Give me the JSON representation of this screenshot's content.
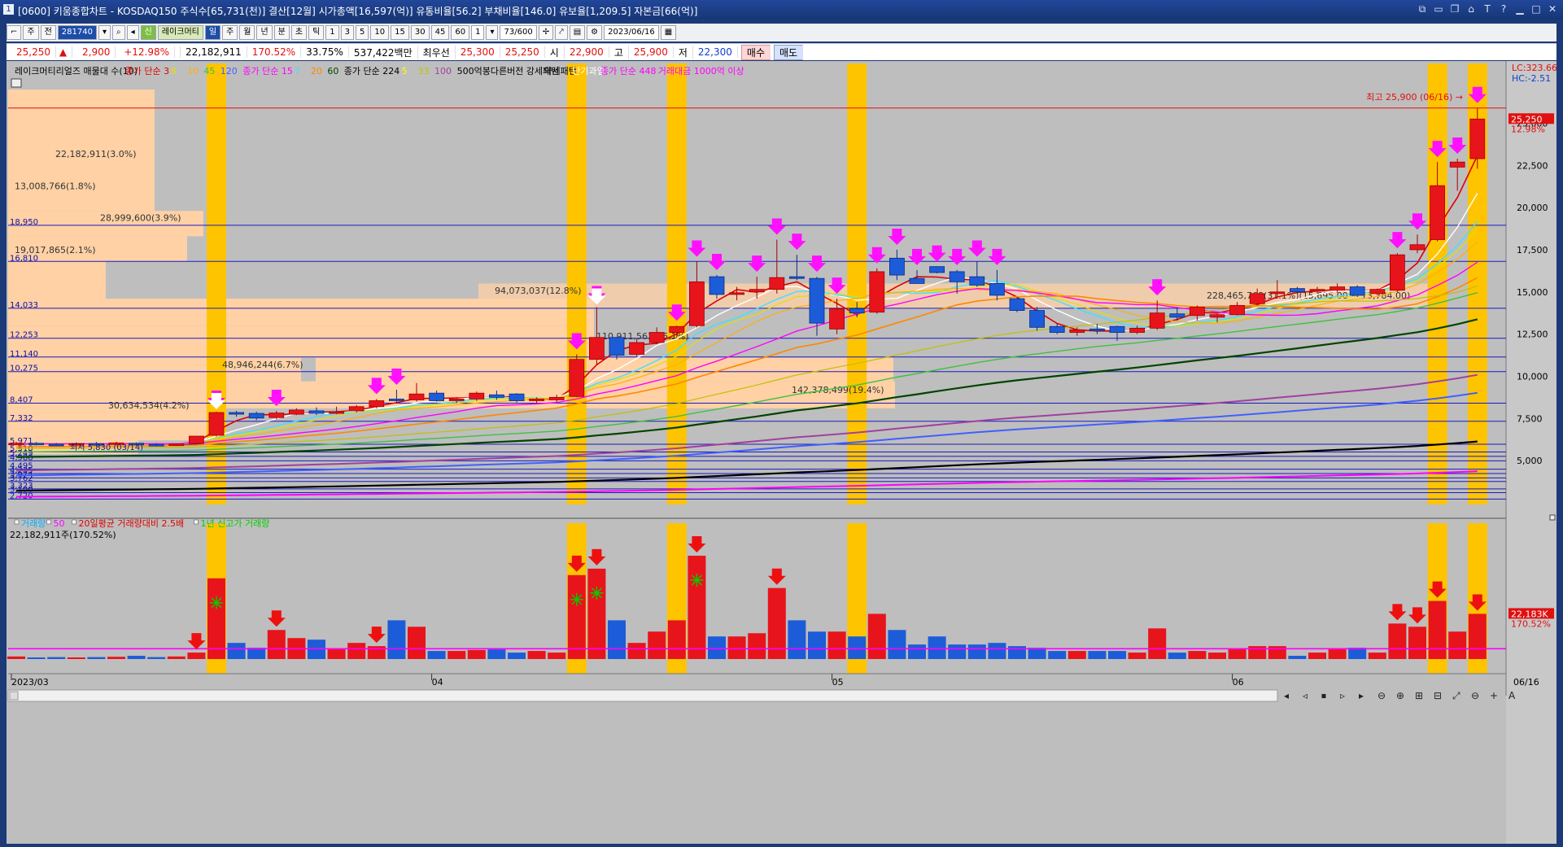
{
  "window": {
    "icon": "1",
    "title": "[0600] 키움종합차트 - KOSDAQ150 주식수[65,731(천)] 결산[12월] 시가총액[16,597(억)] 유통비율[56.2] 부채비율[146.0] 유보율[1,209.5] 자본금[66(억)]"
  },
  "toolbar": {
    "period_label": "주",
    "prev_label": "전",
    "code": "281740",
    "name": "레이크머티",
    "sin_label": "신",
    "periods": [
      "일",
      "주",
      "월",
      "년",
      "분",
      "초",
      "틱"
    ],
    "selected_period": "일",
    "minutes": [
      "1",
      "3",
      "5",
      "10",
      "15",
      "30",
      "45",
      "60"
    ],
    "count_value": "1",
    "data_count": "73",
    "data_max": "/600",
    "date": "2023/06/16"
  },
  "quote": {
    "price": "25,250",
    "change": "2,900",
    "change_pct": "+12.98%",
    "volume": "22,182,911",
    "volume_ratio": "170.52%",
    "turnover": "33.75%",
    "amount": "537,422백만",
    "best_label": "최우선",
    "ask": "25,300",
    "bid": "25,250",
    "open_label": "시",
    "open": "22,900",
    "high_label": "고",
    "high": "25,900",
    "low_label": "저",
    "low": "22,300",
    "buy_label": "매수",
    "sell_label": "매도"
  },
  "colors": {
    "up": "#e8141b",
    "down": "#1d5cd8",
    "profile": "#ffd1a5",
    "highlight": "#ffc400",
    "arrow": "#ff10ff",
    "gridline": "#1a1ac0",
    "background": "#bebebe"
  },
  "legend": [
    {
      "text": "레이크머티리얼즈 매물대 수(10)",
      "color": "#000000"
    },
    {
      "text": "종가 단순 3",
      "color": "#e00000"
    },
    {
      "text": "8",
      "color": "#e0e000"
    },
    {
      "text": "10",
      "color": "#ffb000"
    },
    {
      "text": "45",
      "color": "#40c040"
    },
    {
      "text": "120",
      "color": "#4060ff"
    },
    {
      "text": "종가 단순 15",
      "color": "#ff00ff"
    },
    {
      "text": "7",
      "color": "#40e0ff"
    },
    {
      "text": "20",
      "color": "#ff8800"
    },
    {
      "text": "60",
      "color": "#004400"
    },
    {
      "text": "종가 단순 224",
      "color": "#000000"
    },
    {
      "text": "5",
      "color": "#ffff00"
    },
    {
      "text": "33",
      "color": "#c0c000"
    },
    {
      "text": "100",
      "color": "#a040a0"
    },
    {
      "text": "500억봉다른버전 강세패턴",
      "color": "#000000"
    },
    {
      "text": "약세패턴",
      "color": "#000000"
    },
    {
      "text": "단기과열",
      "color": "#ffffff"
    },
    {
      "text": "종가 단순 448",
      "color": "#ff00ff"
    },
    {
      "text": "거래대금 1000억 이상",
      "color": "#ff00ff"
    }
  ],
  "right_info": {
    "lc": "LC:323.66",
    "hc": "HC:-2.51"
  },
  "price_axis": [
    "25,000",
    "22,500",
    "20,000",
    "17,500",
    "15,000",
    "12,500",
    "10,000",
    "7,500",
    "5,000"
  ],
  "current_tag": {
    "price": "25,250",
    "pct": "12.98%"
  },
  "max_label": "최고 25,900 (06/16) →",
  "price_levels": [
    "18,950",
    "16,810",
    "14,033",
    "12,253",
    "11,140",
    "10,275",
    "8,407",
    "7,332",
    "5,971",
    "5,510",
    "5,249",
    "4,988",
    "4,495",
    "4,235",
    "3,974",
    "3,762",
    "3,323",
    "3,100",
    "2,720"
  ],
  "profile_labels": [
    "22,182,911(3.0%)",
    "13,008,766(1.8%)",
    "28,999,600(3.9%)",
    "19,017,865(2.1%)",
    "94,073,037(12.8%)",
    "110,911,561(15.1%)",
    "48,946,244(6.7%)",
    "30,634,534(4.2%)",
    "142,378,499(19.4%)",
    "228,465,768(31.1%)(15,695.00 ~ 13,784.00)"
  ],
  "min_label": "최저 5,830 (03/14)",
  "volume_legend": [
    {
      "text": "거래량",
      "color": "#00b0ff"
    },
    {
      "text": "50",
      "color": "#ff00ff"
    },
    {
      "text": "20일평균 거래량대비 2.5배",
      "color": "#e00000"
    },
    {
      "text": "1년 신고가 거래량",
      "color": "#00d000"
    }
  ],
  "volume_info": "22,182,911주(170.52%)",
  "volume_tag": {
    "value": "22,183K",
    "pct": "170.52%"
  },
  "date_axis": [
    {
      "label": "2023/03",
      "i": 0
    },
    {
      "label": "04",
      "i": 21
    },
    {
      "label": "05",
      "i": 41
    },
    {
      "label": "06",
      "i": 61
    }
  ],
  "last_date": "06/16",
  "chart_data": {
    "type": "candlestick",
    "symbol_code": "281740",
    "date_range": [
      "2023/03",
      "06/16"
    ],
    "candles": [
      {
        "o": 6000,
        "h": 6120,
        "l": 5920,
        "c": 6030
      },
      {
        "o": 6030,
        "h": 6100,
        "l": 5900,
        "c": 5970
      },
      {
        "o": 5970,
        "h": 6050,
        "l": 5860,
        "c": 5960
      },
      {
        "o": 5960,
        "h": 6080,
        "l": 5900,
        "c": 6010
      },
      {
        "o": 6010,
        "h": 6110,
        "l": 5940,
        "c": 5980
      },
      {
        "o": 5990,
        "h": 6120,
        "l": 5900,
        "c": 6050
      },
      {
        "o": 6030,
        "h": 6080,
        "l": 5880,
        "c": 5960
      },
      {
        "o": 5960,
        "h": 6030,
        "l": 5830,
        "c": 5950
      },
      {
        "o": 5960,
        "h": 6020,
        "l": 5870,
        "c": 5990
      },
      {
        "o": 6010,
        "h": 6450,
        "l": 5980,
        "c": 6450
      },
      {
        "o": 6500,
        "h": 7900,
        "l": 6420,
        "c": 7850
      },
      {
        "o": 7850,
        "h": 7950,
        "l": 7600,
        "c": 7800
      },
      {
        "o": 7800,
        "h": 7900,
        "l": 7400,
        "c": 7520
      },
      {
        "o": 7550,
        "h": 7950,
        "l": 7450,
        "c": 7820
      },
      {
        "o": 7750,
        "h": 8100,
        "l": 7700,
        "c": 8000
      },
      {
        "o": 7950,
        "h": 8150,
        "l": 7700,
        "c": 7800
      },
      {
        "o": 7800,
        "h": 8200,
        "l": 7750,
        "c": 7900
      },
      {
        "o": 7950,
        "h": 8300,
        "l": 7850,
        "c": 8200
      },
      {
        "o": 8200,
        "h": 8650,
        "l": 8100,
        "c": 8550
      },
      {
        "o": 8650,
        "h": 9200,
        "l": 8450,
        "c": 8550
      },
      {
        "o": 8600,
        "h": 9600,
        "l": 8500,
        "c": 8950
      },
      {
        "o": 9000,
        "h": 9150,
        "l": 8500,
        "c": 8550
      },
      {
        "o": 8550,
        "h": 8750,
        "l": 8400,
        "c": 8650
      },
      {
        "o": 8650,
        "h": 9100,
        "l": 8550,
        "c": 9000
      },
      {
        "o": 8900,
        "h": 9150,
        "l": 8600,
        "c": 8750
      },
      {
        "o": 8950,
        "h": 9000,
        "l": 8450,
        "c": 8550
      },
      {
        "o": 8550,
        "h": 8750,
        "l": 8400,
        "c": 8650
      },
      {
        "o": 8600,
        "h": 8900,
        "l": 8450,
        "c": 8750
      },
      {
        "o": 8800,
        "h": 11300,
        "l": 8750,
        "c": 11000
      },
      {
        "o": 11000,
        "h": 14100,
        "l": 10700,
        "c": 12300
      },
      {
        "o": 12300,
        "h": 12350,
        "l": 11000,
        "c": 11250
      },
      {
        "o": 11300,
        "h": 12200,
        "l": 11200,
        "c": 12000
      },
      {
        "o": 12000,
        "h": 12900,
        "l": 11900,
        "c": 12600
      },
      {
        "o": 12600,
        "h": 13000,
        "l": 12300,
        "c": 12950
      },
      {
        "o": 13000,
        "h": 16800,
        "l": 12900,
        "c": 15600
      },
      {
        "o": 15900,
        "h": 16000,
        "l": 14600,
        "c": 14850
      },
      {
        "o": 14850,
        "h": 15300,
        "l": 14500,
        "c": 14950
      },
      {
        "o": 15000,
        "h": 15900,
        "l": 14600,
        "c": 15150
      },
      {
        "o": 15150,
        "h": 18100,
        "l": 14900,
        "c": 15850
      },
      {
        "o": 15900,
        "h": 17200,
        "l": 15700,
        "c": 15800
      },
      {
        "o": 15800,
        "h": 15900,
        "l": 12400,
        "c": 13150
      },
      {
        "o": 12800,
        "h": 14600,
        "l": 12500,
        "c": 14000
      },
      {
        "o": 14000,
        "h": 14400,
        "l": 13500,
        "c": 13750
      },
      {
        "o": 13800,
        "h": 16400,
        "l": 13700,
        "c": 16200
      },
      {
        "o": 17000,
        "h": 17500,
        "l": 15700,
        "c": 16000
      },
      {
        "o": 15800,
        "h": 16300,
        "l": 15500,
        "c": 15500
      },
      {
        "o": 16500,
        "h": 16500,
        "l": 16100,
        "c": 16150
      },
      {
        "o": 16200,
        "h": 16300,
        "l": 14900,
        "c": 15600
      },
      {
        "o": 15900,
        "h": 16800,
        "l": 15300,
        "c": 15400
      },
      {
        "o": 15500,
        "h": 16300,
        "l": 14500,
        "c": 14800
      },
      {
        "o": 14600,
        "h": 14700,
        "l": 13800,
        "c": 13900
      },
      {
        "o": 13900,
        "h": 14100,
        "l": 12700,
        "c": 12900
      },
      {
        "o": 12950,
        "h": 13100,
        "l": 12500,
        "c": 12600
      },
      {
        "o": 12600,
        "h": 12900,
        "l": 12400,
        "c": 12750
      },
      {
        "o": 12800,
        "h": 13100,
        "l": 12500,
        "c": 12700
      },
      {
        "o": 12950,
        "h": 13000,
        "l": 12100,
        "c": 12600
      },
      {
        "o": 12600,
        "h": 13000,
        "l": 12500,
        "c": 12850
      },
      {
        "o": 12850,
        "h": 14500,
        "l": 12750,
        "c": 13750
      },
      {
        "o": 13700,
        "h": 14100,
        "l": 13300,
        "c": 13500
      },
      {
        "o": 13600,
        "h": 14200,
        "l": 13300,
        "c": 14100
      },
      {
        "o": 13500,
        "h": 13700,
        "l": 13200,
        "c": 13650
      },
      {
        "o": 13650,
        "h": 14400,
        "l": 13600,
        "c": 14200
      },
      {
        "o": 14300,
        "h": 15200,
        "l": 14200,
        "c": 14900
      },
      {
        "o": 14900,
        "h": 15700,
        "l": 14700,
        "c": 15000
      },
      {
        "o": 15200,
        "h": 15300,
        "l": 14900,
        "c": 15000
      },
      {
        "o": 15050,
        "h": 15300,
        "l": 14900,
        "c": 15150
      },
      {
        "o": 15100,
        "h": 15500,
        "l": 14950,
        "c": 15300
      },
      {
        "o": 15300,
        "h": 15400,
        "l": 14700,
        "c": 14800
      },
      {
        "o": 14900,
        "h": 15200,
        "l": 14800,
        "c": 15150
      },
      {
        "o": 15100,
        "h": 17300,
        "l": 15000,
        "c": 17200
      },
      {
        "o": 17500,
        "h": 18400,
        "l": 17300,
        "c": 17800
      },
      {
        "o": 18100,
        "h": 22700,
        "l": 18000,
        "c": 21300
      },
      {
        "o": 22400,
        "h": 22900,
        "l": 21000,
        "c": 22700
      },
      {
        "o": 22900,
        "h": 25900,
        "l": 22300,
        "c": 25250
      }
    ],
    "volume": [
      0.8,
      0.5,
      0.6,
      0.5,
      0.6,
      0.7,
      1.0,
      0.6,
      0.8,
      2.0,
      25.0,
      5.0,
      3.5,
      9.0,
      6.5,
      6.0,
      3.0,
      5.0,
      4.0,
      12.0,
      10.0,
      2.5,
      2.5,
      2.8,
      3.0,
      2.0,
      2.5,
      2.0,
      26.0,
      28.0,
      12.0,
      5.0,
      8.5,
      12.0,
      32.0,
      7.0,
      7.0,
      8.0,
      22.0,
      12.0,
      8.5,
      8.5,
      7.0,
      14.0,
      9.0,
      4.5,
      7.0,
      4.5,
      4.5,
      5.0,
      4.0,
      3.5,
      2.5,
      2.5,
      2.5,
      2.5,
      2.0,
      9.5,
      2.0,
      2.5,
      2.0,
      3.0,
      4.0,
      4.0,
      1.0,
      2.0,
      3.0,
      3.5,
      2.0,
      11.0,
      10.0,
      18.0,
      8.5,
      14.0
    ],
    "volume_ylim": [
      0,
      32
    ],
    "price_ylim": [
      2400,
      27000
    ],
    "up_arrows_on_close": [
      10,
      13,
      18,
      19,
      28,
      29,
      33,
      34,
      35,
      37,
      38,
      39,
      40,
      41,
      43,
      44,
      45,
      46,
      47,
      48,
      49,
      57,
      69,
      70,
      71,
      72,
      73
    ],
    "white_arrows": [
      10,
      29
    ],
    "volume_arrows": [
      9,
      13,
      18,
      28,
      29,
      34,
      38,
      69,
      70,
      71,
      73
    ],
    "volume_stars": [
      10,
      28,
      29,
      34
    ],
    "highlight_bars": [
      10,
      28,
      33,
      42,
      71,
      73
    ]
  }
}
